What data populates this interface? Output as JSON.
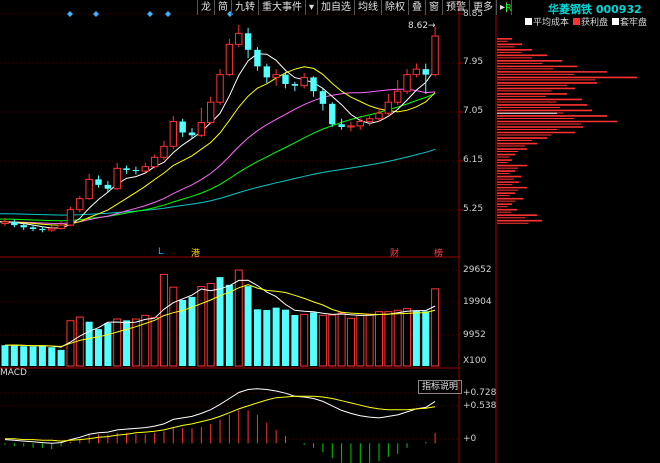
{
  "toolbar": {
    "items": [
      "龙",
      "简",
      "九转",
      "重大事件",
      "▾",
      "加自选",
      "均线",
      "除权",
      "叠",
      "窗",
      "预警",
      "更多"
    ]
  },
  "stock": {
    "name_code": "华菱钢铁 000932",
    "period_flag": "R"
  },
  "legend": {
    "avg_cost": "平均成本",
    "profit": "获利盘",
    "trapped": "套牢盘"
  },
  "price_axis": {
    "labels": [
      "8.85",
      "7.95",
      "7.05",
      "6.15",
      "5.25"
    ],
    "high_marker": "8.62"
  },
  "volume_axis": {
    "labels": [
      "29652",
      "19904",
      "9952",
      "X100"
    ]
  },
  "indicator_axis": {
    "labels": [
      "+0.728",
      "+0.538",
      "+0"
    ]
  },
  "event_markers": [
    {
      "text": "L",
      "color": "#00c8ff"
    },
    {
      "text": "港",
      "color": "#ffd800"
    },
    {
      "text": "财",
      "color": "#ff4040"
    },
    {
      "text": "榜",
      "color": "#ff4040"
    }
  ],
  "indicator_panel": {
    "name": "MACD",
    "button": "指标说明"
  },
  "colors": {
    "up": "#ff3232",
    "down": "#54ffff",
    "ma5": "#ffffff",
    "ma10": "#ffff00",
    "ma20": "#ff66ff",
    "ma30": "#00ff00",
    "ma60": "#00c8c8",
    "diamond": "#40b0ff"
  },
  "chart_data": {
    "type": "candlestick",
    "price_range": [
      4.75,
      8.85
    ],
    "candles": [
      [
        5.05,
        5.08,
        5.15,
        5.0
      ],
      [
        5.08,
        5.02,
        5.12,
        4.98
      ],
      [
        5.02,
        4.98,
        5.06,
        4.93
      ],
      [
        4.98,
        4.95,
        5.03,
        4.91
      ],
      [
        4.95,
        4.93,
        4.99,
        4.89
      ],
      [
        4.93,
        4.96,
        5.02,
        4.9
      ],
      [
        4.96,
        5.02,
        5.1,
        4.94
      ],
      [
        5.02,
        5.3,
        5.35,
        5.0
      ],
      [
        5.3,
        5.5,
        5.55,
        5.25
      ],
      [
        5.5,
        5.85,
        5.95,
        5.48
      ],
      [
        5.85,
        5.75,
        5.92,
        5.7
      ],
      [
        5.75,
        5.68,
        5.82,
        5.62
      ],
      [
        5.68,
        6.05,
        6.15,
        5.66
      ],
      [
        6.05,
        6.02,
        6.1,
        5.95
      ],
      [
        6.02,
        6.0,
        6.08,
        5.94
      ],
      [
        6.0,
        6.08,
        6.15,
        5.98
      ],
      [
        6.08,
        6.25,
        6.3,
        6.05
      ],
      [
        6.25,
        6.45,
        6.55,
        6.2
      ],
      [
        6.45,
        6.9,
        7.0,
        6.4
      ],
      [
        6.9,
        6.7,
        6.95,
        6.62
      ],
      [
        6.7,
        6.65,
        6.78,
        6.6
      ],
      [
        6.65,
        6.88,
        7.15,
        6.62
      ],
      [
        6.88,
        7.25,
        7.35,
        6.85
      ],
      [
        7.25,
        7.75,
        7.85,
        7.2
      ],
      [
        7.75,
        8.3,
        8.4,
        7.72
      ],
      [
        8.3,
        8.5,
        8.65,
        8.25
      ],
      [
        8.5,
        8.2,
        8.6,
        8.05
      ],
      [
        8.2,
        7.9,
        8.25,
        7.82
      ],
      [
        7.9,
        7.7,
        7.95,
        7.6
      ],
      [
        7.7,
        7.75,
        7.85,
        7.55
      ],
      [
        7.75,
        7.58,
        7.8,
        7.5
      ],
      [
        7.58,
        7.55,
        7.62,
        7.45
      ],
      [
        7.55,
        7.7,
        7.78,
        7.5
      ],
      [
        7.7,
        7.45,
        7.72,
        7.35
      ],
      [
        7.45,
        7.22,
        7.5,
        7.1
      ],
      [
        7.22,
        6.85,
        7.25,
        6.8
      ],
      [
        6.85,
        6.8,
        6.95,
        6.75
      ],
      [
        6.8,
        6.82,
        6.9,
        6.72
      ],
      [
        6.82,
        6.9,
        6.95,
        6.75
      ],
      [
        6.9,
        6.95,
        7.0,
        6.82
      ],
      [
        6.95,
        7.05,
        7.15,
        6.9
      ],
      [
        7.05,
        7.25,
        7.4,
        7.0
      ],
      [
        7.25,
        7.45,
        7.65,
        7.2
      ],
      [
        7.45,
        7.75,
        7.85,
        7.4
      ],
      [
        7.75,
        7.85,
        7.95,
        7.7
      ],
      [
        7.85,
        7.75,
        7.95,
        7.4
      ],
      [
        7.75,
        8.45,
        8.62,
        7.72
      ]
    ],
    "volume_range": [
      0,
      31000
    ],
    "volumes": [
      [
        6200,
        0
      ],
      [
        6300,
        0
      ],
      [
        5900,
        0
      ],
      [
        5800,
        0
      ],
      [
        6000,
        0
      ],
      [
        5600,
        0
      ],
      [
        4800,
        0
      ],
      [
        13500,
        1
      ],
      [
        14600,
        1
      ],
      [
        13200,
        0
      ],
      [
        11000,
        0
      ],
      [
        12800,
        0
      ],
      [
        14000,
        1
      ],
      [
        13600,
        0
      ],
      [
        14000,
        1
      ],
      [
        15100,
        1
      ],
      [
        14500,
        1
      ],
      [
        27300,
        1
      ],
      [
        23500,
        1
      ],
      [
        19700,
        0
      ],
      [
        20600,
        0
      ],
      [
        23700,
        1
      ],
      [
        24600,
        1
      ],
      [
        26500,
        0
      ],
      [
        24200,
        0
      ],
      [
        28600,
        1
      ],
      [
        23800,
        0
      ],
      [
        16900,
        0
      ],
      [
        16700,
        0
      ],
      [
        17400,
        0
      ],
      [
        16800,
        0
      ],
      [
        15200,
        0
      ],
      [
        15400,
        1
      ],
      [
        16000,
        0
      ],
      [
        15100,
        1
      ],
      [
        15200,
        1
      ],
      [
        15800,
        1
      ],
      [
        14200,
        1
      ],
      [
        15100,
        1
      ],
      [
        15400,
        1
      ],
      [
        16200,
        1
      ],
      [
        16200,
        1
      ],
      [
        16600,
        1
      ],
      [
        17100,
        1
      ],
      [
        16400,
        0
      ],
      [
        16300,
        0
      ],
      [
        23000,
        1
      ]
    ],
    "macd_range": [
      -0.25,
      0.78
    ],
    "dif": [
      0.05,
      0.04,
      0.03,
      0.02,
      0.01,
      0.0,
      0.01,
      0.05,
      0.08,
      0.12,
      0.14,
      0.15,
      0.18,
      0.19,
      0.2,
      0.21,
      0.23,
      0.26,
      0.32,
      0.34,
      0.36,
      0.4,
      0.45,
      0.52,
      0.6,
      0.68,
      0.72,
      0.73,
      0.72,
      0.7,
      0.67,
      0.63,
      0.62,
      0.6,
      0.56,
      0.5,
      0.44,
      0.4,
      0.37,
      0.35,
      0.34,
      0.36,
      0.38,
      0.42,
      0.46,
      0.48,
      0.56
    ],
    "dea": [
      0.06,
      0.06,
      0.05,
      0.05,
      0.04,
      0.04,
      0.03,
      0.04,
      0.05,
      0.06,
      0.08,
      0.09,
      0.11,
      0.12,
      0.14,
      0.15,
      0.16,
      0.18,
      0.21,
      0.24,
      0.26,
      0.29,
      0.32,
      0.36,
      0.41,
      0.46,
      0.5,
      0.54,
      0.58,
      0.61,
      0.62,
      0.63,
      0.63,
      0.63,
      0.62,
      0.6,
      0.57,
      0.54,
      0.51,
      0.48,
      0.46,
      0.45,
      0.45,
      0.45,
      0.46,
      0.47,
      0.49
    ],
    "profit_chips": [
      {
        "p": 5.1,
        "w": 45
      },
      {
        "p": 5.2,
        "w": 40
      },
      {
        "p": 5.3,
        "w": 20
      },
      {
        "p": 5.4,
        "w": 15
      },
      {
        "p": 5.5,
        "w": 26
      },
      {
        "p": 5.6,
        "w": 18
      },
      {
        "p": 5.7,
        "w": 30
      },
      {
        "p": 5.8,
        "w": 22
      },
      {
        "p": 5.9,
        "w": 24
      },
      {
        "p": 6.0,
        "w": 18
      },
      {
        "p": 6.1,
        "w": 30
      },
      {
        "p": 6.2,
        "w": 15
      },
      {
        "p": 6.3,
        "w": 18
      },
      {
        "p": 6.4,
        "w": 30
      },
      {
        "p": 6.5,
        "w": 40
      },
      {
        "p": 6.6,
        "w": 50
      },
      {
        "p": 6.7,
        "w": 78
      },
      {
        "p": 6.8,
        "w": 86
      },
      {
        "p": 6.9,
        "w": 120
      },
      {
        "p": 7.0,
        "w": 110
      },
      {
        "p": 7.1,
        "w": 95
      },
      {
        "p": 7.2,
        "w": 90
      },
      {
        "p": 7.3,
        "w": 85
      },
      {
        "p": 7.4,
        "w": 70
      },
      {
        "p": 7.5,
        "w": 78
      },
      {
        "p": 7.6,
        "w": 100
      },
      {
        "p": 7.7,
        "w": 140
      },
      {
        "p": 7.8,
        "w": 110
      },
      {
        "p": 7.9,
        "w": 80
      },
      {
        "p": 8.0,
        "w": 65
      },
      {
        "p": 8.1,
        "w": 50
      },
      {
        "p": 8.2,
        "w": 35
      },
      {
        "p": 8.3,
        "w": 25
      },
      {
        "p": 8.4,
        "w": 15
      }
    ]
  }
}
